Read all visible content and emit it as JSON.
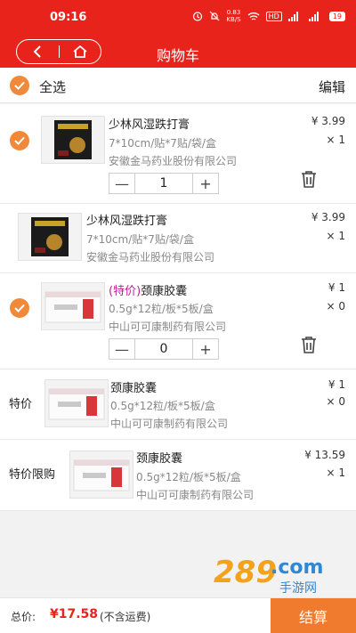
{
  "status_bar": {
    "time": "09:16",
    "net_speed": "0.83",
    "net_unit": "KB/S",
    "hd": "HD",
    "battery": "19"
  },
  "nav": {
    "title": "购物车",
    "back_icon": "back-arrow-icon",
    "home_icon": "home-icon"
  },
  "select_all": {
    "label": "全选",
    "edit_label": "编辑",
    "checked": true
  },
  "items": [
    {
      "tag": "",
      "name": "少林风湿跌打膏",
      "spec": "7*10cm/贴*7贴/袋/盒",
      "maker": "安徽金马药业股份有限公司",
      "price": "¥ 3.99",
      "qty": "× 1",
      "quantity": "1",
      "checked": true
    },
    {
      "tag": "",
      "name": "少林风湿跌打膏",
      "spec": "7*10cm/贴*7贴/袋/盒",
      "maker": "安徽金马药业股份有限公司",
      "price": "¥ 3.99",
      "qty": "× 1"
    },
    {
      "tag": "(特价)",
      "name": "颈康胶囊",
      "spec": "0.5g*12粒/板*5板/盒",
      "maker": "中山可可康制药有限公司",
      "price": "¥ 1",
      "qty": "× 0",
      "quantity": "0",
      "checked": true
    },
    {
      "left_label": "特价",
      "name": "颈康胶囊",
      "spec": "0.5g*12粒/板*5板/盒",
      "maker": "中山可可康制药有限公司",
      "price": "¥ 1",
      "qty": "× 0"
    },
    {
      "left_label": "特价限购",
      "name": "颈康胶囊",
      "spec": "0.5g*12粒/板*5板/盒",
      "maker": "中山可可康制药有限公司",
      "price": "¥ 13.59",
      "qty": "× 1"
    }
  ],
  "stepper": {
    "minus": "—",
    "plus": "+"
  },
  "footer": {
    "total_label": "总价:",
    "total_value": "¥17.58",
    "note": "(不含运费)",
    "checkout_label": "结算"
  },
  "watermark": {
    "text": "289",
    "sub": "手游网",
    "dot": ".com"
  },
  "colors": {
    "brand_red": "#e8231b",
    "accent_orange": "#f08a3a",
    "checkout": "#f07a2d",
    "special_tag": "#c21a9a"
  }
}
